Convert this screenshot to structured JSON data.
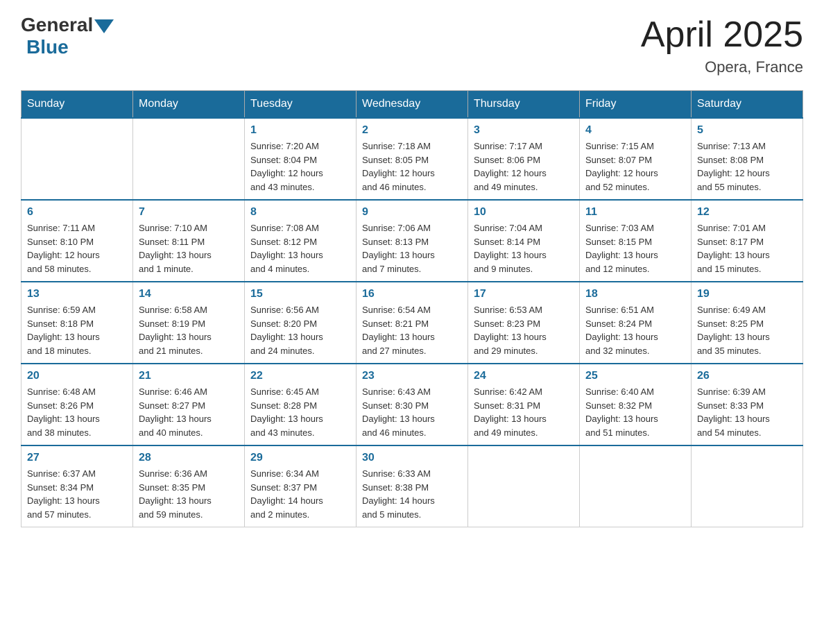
{
  "header": {
    "logo_general": "General",
    "logo_blue": "Blue",
    "month_year": "April 2025",
    "location": "Opera, France"
  },
  "weekdays": [
    "Sunday",
    "Monday",
    "Tuesday",
    "Wednesday",
    "Thursday",
    "Friday",
    "Saturday"
  ],
  "weeks": [
    [
      {
        "day": "",
        "info": ""
      },
      {
        "day": "",
        "info": ""
      },
      {
        "day": "1",
        "info": "Sunrise: 7:20 AM\nSunset: 8:04 PM\nDaylight: 12 hours\nand 43 minutes."
      },
      {
        "day": "2",
        "info": "Sunrise: 7:18 AM\nSunset: 8:05 PM\nDaylight: 12 hours\nand 46 minutes."
      },
      {
        "day": "3",
        "info": "Sunrise: 7:17 AM\nSunset: 8:06 PM\nDaylight: 12 hours\nand 49 minutes."
      },
      {
        "day": "4",
        "info": "Sunrise: 7:15 AM\nSunset: 8:07 PM\nDaylight: 12 hours\nand 52 minutes."
      },
      {
        "day": "5",
        "info": "Sunrise: 7:13 AM\nSunset: 8:08 PM\nDaylight: 12 hours\nand 55 minutes."
      }
    ],
    [
      {
        "day": "6",
        "info": "Sunrise: 7:11 AM\nSunset: 8:10 PM\nDaylight: 12 hours\nand 58 minutes."
      },
      {
        "day": "7",
        "info": "Sunrise: 7:10 AM\nSunset: 8:11 PM\nDaylight: 13 hours\nand 1 minute."
      },
      {
        "day": "8",
        "info": "Sunrise: 7:08 AM\nSunset: 8:12 PM\nDaylight: 13 hours\nand 4 minutes."
      },
      {
        "day": "9",
        "info": "Sunrise: 7:06 AM\nSunset: 8:13 PM\nDaylight: 13 hours\nand 7 minutes."
      },
      {
        "day": "10",
        "info": "Sunrise: 7:04 AM\nSunset: 8:14 PM\nDaylight: 13 hours\nand 9 minutes."
      },
      {
        "day": "11",
        "info": "Sunrise: 7:03 AM\nSunset: 8:15 PM\nDaylight: 13 hours\nand 12 minutes."
      },
      {
        "day": "12",
        "info": "Sunrise: 7:01 AM\nSunset: 8:17 PM\nDaylight: 13 hours\nand 15 minutes."
      }
    ],
    [
      {
        "day": "13",
        "info": "Sunrise: 6:59 AM\nSunset: 8:18 PM\nDaylight: 13 hours\nand 18 minutes."
      },
      {
        "day": "14",
        "info": "Sunrise: 6:58 AM\nSunset: 8:19 PM\nDaylight: 13 hours\nand 21 minutes."
      },
      {
        "day": "15",
        "info": "Sunrise: 6:56 AM\nSunset: 8:20 PM\nDaylight: 13 hours\nand 24 minutes."
      },
      {
        "day": "16",
        "info": "Sunrise: 6:54 AM\nSunset: 8:21 PM\nDaylight: 13 hours\nand 27 minutes."
      },
      {
        "day": "17",
        "info": "Sunrise: 6:53 AM\nSunset: 8:23 PM\nDaylight: 13 hours\nand 29 minutes."
      },
      {
        "day": "18",
        "info": "Sunrise: 6:51 AM\nSunset: 8:24 PM\nDaylight: 13 hours\nand 32 minutes."
      },
      {
        "day": "19",
        "info": "Sunrise: 6:49 AM\nSunset: 8:25 PM\nDaylight: 13 hours\nand 35 minutes."
      }
    ],
    [
      {
        "day": "20",
        "info": "Sunrise: 6:48 AM\nSunset: 8:26 PM\nDaylight: 13 hours\nand 38 minutes."
      },
      {
        "day": "21",
        "info": "Sunrise: 6:46 AM\nSunset: 8:27 PM\nDaylight: 13 hours\nand 40 minutes."
      },
      {
        "day": "22",
        "info": "Sunrise: 6:45 AM\nSunset: 8:28 PM\nDaylight: 13 hours\nand 43 minutes."
      },
      {
        "day": "23",
        "info": "Sunrise: 6:43 AM\nSunset: 8:30 PM\nDaylight: 13 hours\nand 46 minutes."
      },
      {
        "day": "24",
        "info": "Sunrise: 6:42 AM\nSunset: 8:31 PM\nDaylight: 13 hours\nand 49 minutes."
      },
      {
        "day": "25",
        "info": "Sunrise: 6:40 AM\nSunset: 8:32 PM\nDaylight: 13 hours\nand 51 minutes."
      },
      {
        "day": "26",
        "info": "Sunrise: 6:39 AM\nSunset: 8:33 PM\nDaylight: 13 hours\nand 54 minutes."
      }
    ],
    [
      {
        "day": "27",
        "info": "Sunrise: 6:37 AM\nSunset: 8:34 PM\nDaylight: 13 hours\nand 57 minutes."
      },
      {
        "day": "28",
        "info": "Sunrise: 6:36 AM\nSunset: 8:35 PM\nDaylight: 13 hours\nand 59 minutes."
      },
      {
        "day": "29",
        "info": "Sunrise: 6:34 AM\nSunset: 8:37 PM\nDaylight: 14 hours\nand 2 minutes."
      },
      {
        "day": "30",
        "info": "Sunrise: 6:33 AM\nSunset: 8:38 PM\nDaylight: 14 hours\nand 5 minutes."
      },
      {
        "day": "",
        "info": ""
      },
      {
        "day": "",
        "info": ""
      },
      {
        "day": "",
        "info": ""
      }
    ]
  ]
}
